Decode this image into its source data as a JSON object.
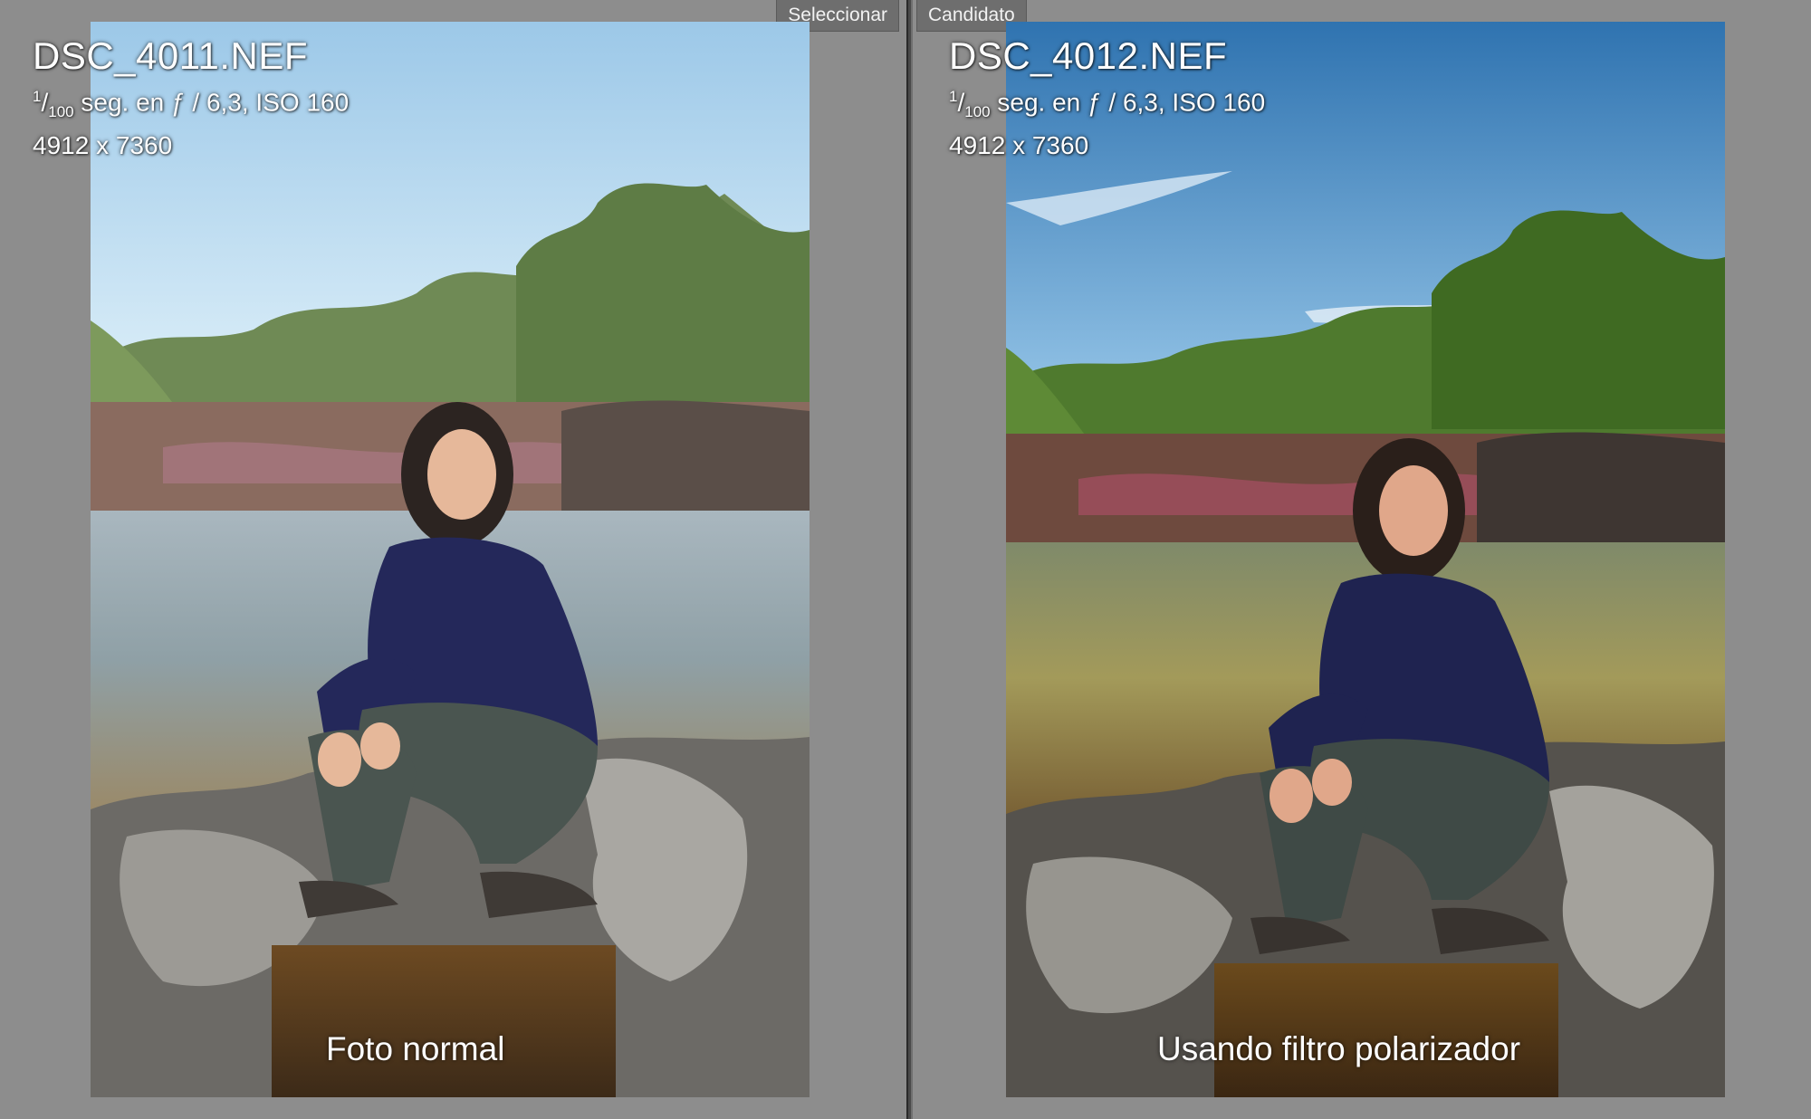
{
  "left_panel": {
    "tab_label": "Seleccionar",
    "filename": "DSC_4011.NEF",
    "exposure": {
      "numerator": "1",
      "denominator": "100",
      "rest": "seg. en ƒ / 6,3, ISO 160"
    },
    "dimensions": "4912 x 7360",
    "caption": "Foto normal",
    "sky_top": "#9cc8e8",
    "sky_bottom": "#d6ebf7"
  },
  "right_panel": {
    "tab_label": "Candidato",
    "filename": "DSC_4012.NEF",
    "exposure": {
      "numerator": "1",
      "denominator": "100",
      "rest": "seg. en ƒ / 6,3, ISO 160"
    },
    "dimensions": "4912 x 7360",
    "caption": "Usando filtro polarizador",
    "sky_top": "#2f73b0",
    "sky_bottom": "#8fc0e4"
  },
  "colors": {
    "background": "#8d8d8d",
    "tab_background": "#6e6e6e",
    "divider": "#4a4a4a"
  }
}
